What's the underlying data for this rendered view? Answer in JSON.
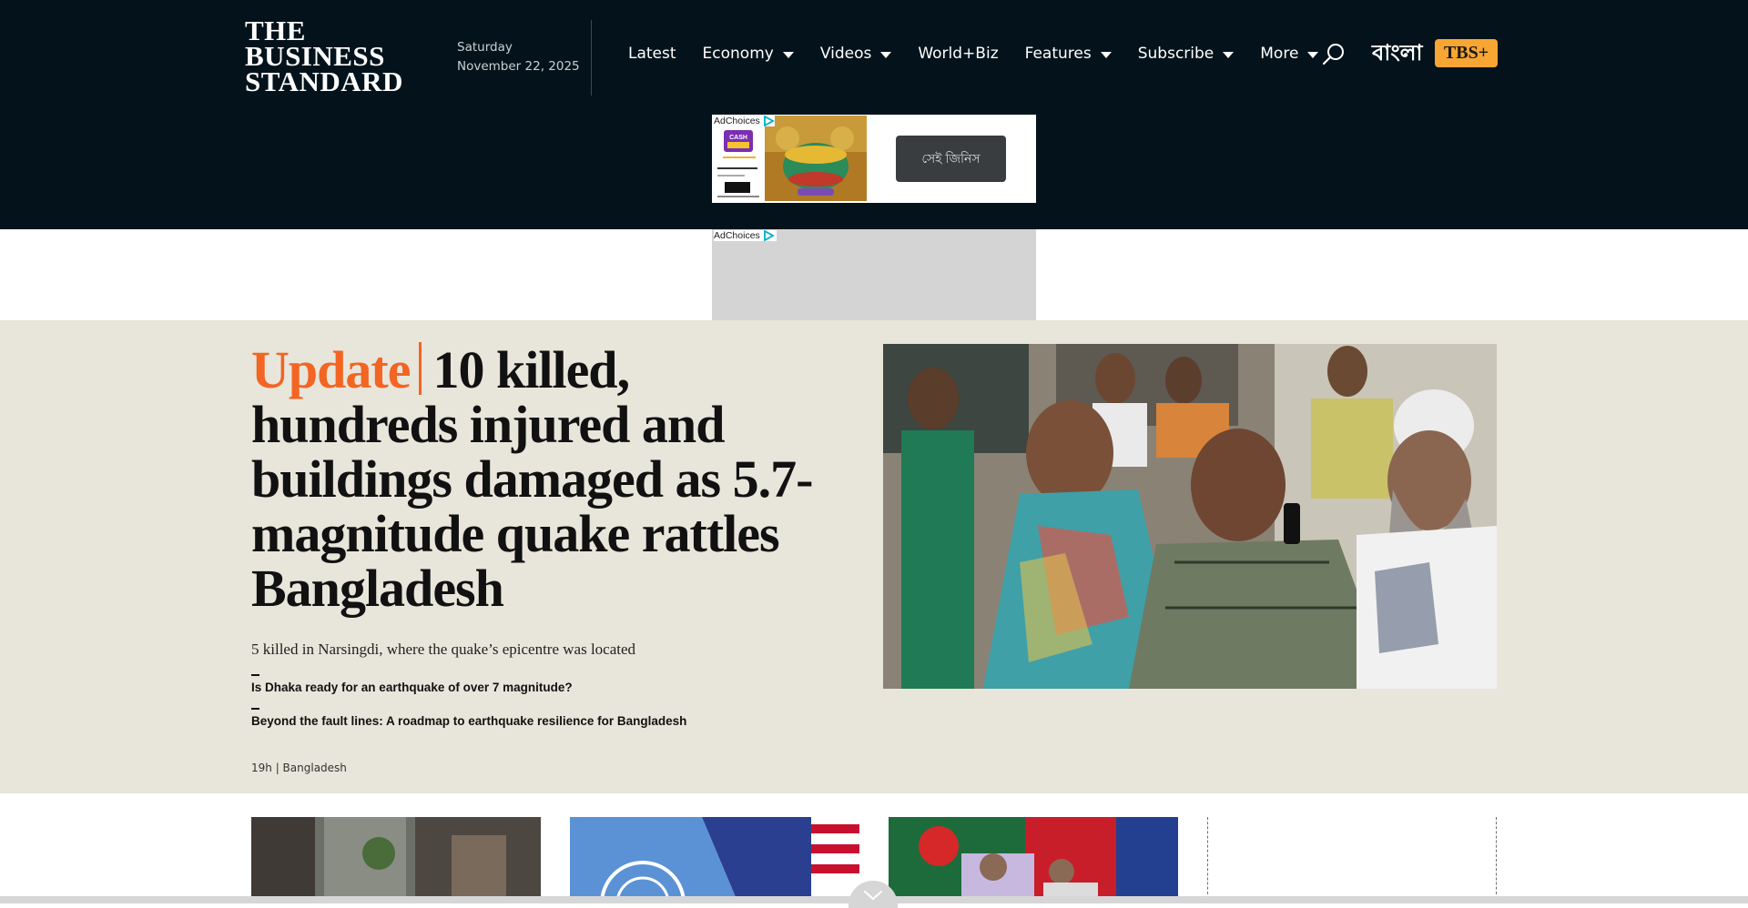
{
  "header": {
    "logo_line1": "THE",
    "logo_line2": "BUSINESS",
    "logo_line3": "STANDARD",
    "day": "Saturday",
    "date": "November 22, 2025",
    "nav": [
      {
        "label": "Latest",
        "has_dropdown": false
      },
      {
        "label": "Economy",
        "has_dropdown": true
      },
      {
        "label": "Videos",
        "has_dropdown": true
      },
      {
        "label": "World+Biz",
        "has_dropdown": false
      },
      {
        "label": "Features",
        "has_dropdown": true
      },
      {
        "label": "Subscribe",
        "has_dropdown": true
      },
      {
        "label": "More",
        "has_dropdown": true
      }
    ],
    "search_icon": "search-icon",
    "bangla_label": "বাংলা",
    "tbs_plus_label": "TBS+",
    "colors": {
      "background": "#04131b",
      "accent": "#f7a533"
    }
  },
  "ads": {
    "adchoices_label": "AdChoices",
    "cta_label": "সেই জিনিস",
    "left_thumb_text": "CASH"
  },
  "hero": {
    "tag": "Update",
    "headline": "10 killed, hundreds injured and buildings damaged as 5.7-magnitude quake rattles Bangladesh",
    "subheadline": "5 killed in Narsingdi, where the quake’s epicentre was located",
    "related": [
      "Is Dhaka ready for an earthquake of over 7 magnitude?",
      "Beyond the fault lines: A roadmap to earthquake resilience for Bangladesh"
    ],
    "meta": "19h | Bangladesh",
    "colors": {
      "background": "#e8e5db",
      "tag": "#f26522"
    }
  }
}
